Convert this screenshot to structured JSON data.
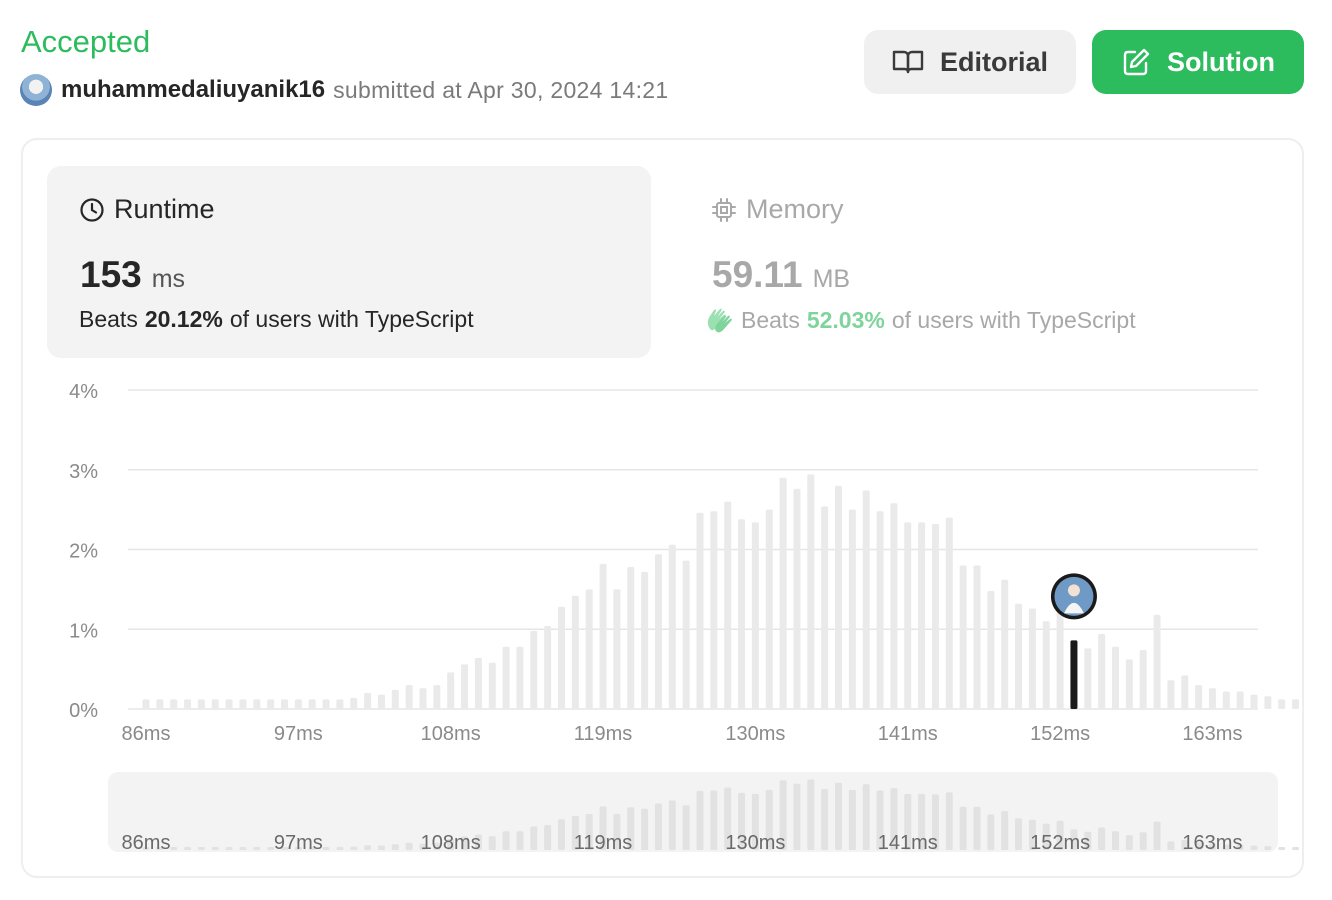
{
  "header": {
    "status": "Accepted",
    "username": "muhammedaliuyanik16",
    "submitted_text": "submitted at Apr 30, 2024 14:21"
  },
  "buttons": {
    "editorial": "Editorial",
    "solution": "Solution"
  },
  "runtime": {
    "title": "Runtime",
    "value": "153",
    "unit": "ms",
    "beats_prefix": "Beats",
    "beats_pct": "20.12%",
    "beats_suffix": "of users with TypeScript"
  },
  "memory": {
    "title": "Memory",
    "value": "59.11",
    "unit": "MB",
    "beats_prefix": "Beats",
    "beats_pct": "52.03%",
    "beats_suffix": "of users with TypeScript"
  },
  "colors": {
    "accent_green": "#2cbb5d",
    "bar": "#eaeaea",
    "highlight_bar": "#1a1a1a",
    "grid": "#e6e6e6"
  },
  "chart_data": {
    "type": "bar",
    "title": "",
    "xlabel": "",
    "ylabel": "",
    "ylim": [
      0,
      4
    ],
    "y_ticks": [
      "0%",
      "1%",
      "2%",
      "3%",
      "4%"
    ],
    "x_start_ms": 86,
    "x_step_ms": 1,
    "x_tick_labels": [
      "86ms",
      "97ms",
      "108ms",
      "119ms",
      "130ms",
      "141ms",
      "152ms",
      "163ms"
    ],
    "x_tick_values": [
      86,
      97,
      108,
      119,
      130,
      141,
      152,
      163
    ],
    "values": [
      0.12,
      0.12,
      0.12,
      0.12,
      0.12,
      0.12,
      0.12,
      0.12,
      0.12,
      0.12,
      0.12,
      0.12,
      0.12,
      0.12,
      0.12,
      0.14,
      0.2,
      0.18,
      0.24,
      0.3,
      0.26,
      0.3,
      0.46,
      0.56,
      0.64,
      0.58,
      0.78,
      0.78,
      0.98,
      1.04,
      1.28,
      1.42,
      1.5,
      1.82,
      1.5,
      1.78,
      1.72,
      1.94,
      2.06,
      1.86,
      2.46,
      2.48,
      2.6,
      2.38,
      2.34,
      2.5,
      2.9,
      2.76,
      2.94,
      2.54,
      2.8,
      2.5,
      2.74,
      2.48,
      2.58,
      2.34,
      2.34,
      2.32,
      2.4,
      1.8,
      1.8,
      1.48,
      1.62,
      1.32,
      1.26,
      1.1,
      1.22,
      0.86,
      0.76,
      0.94,
      0.78,
      0.62,
      0.74,
      1.18,
      0.36,
      0.42,
      0.3,
      0.26,
      0.22,
      0.22,
      0.18,
      0.16,
      0.12,
      0.12
    ],
    "highlight_index": 67,
    "highlight_label": "153ms"
  }
}
